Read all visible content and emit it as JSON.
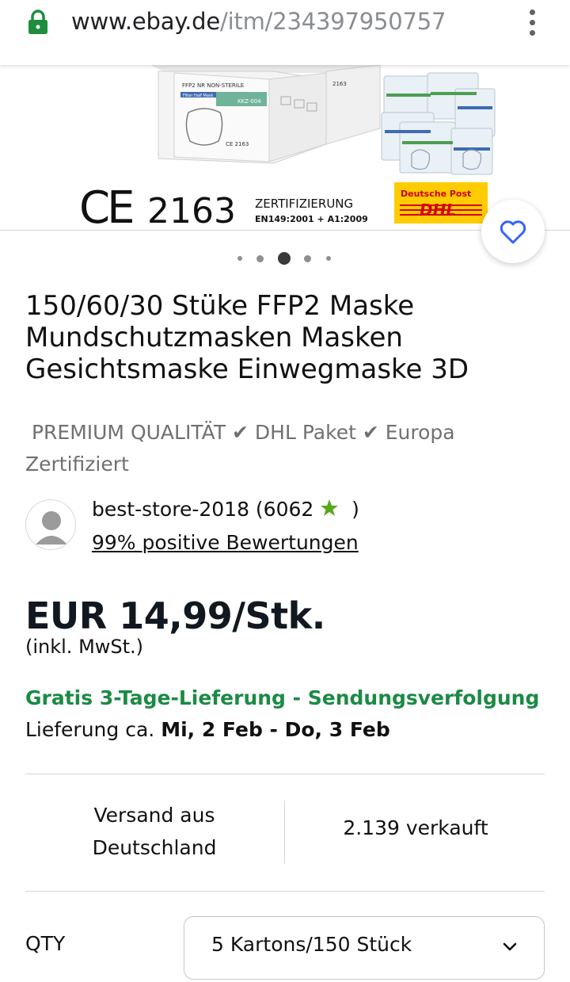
{
  "browser": {
    "url_host": "www.ebay.de",
    "url_path": "/itm/234397950757",
    "lock_icon": "lock-icon",
    "menu_icon": "more-vert-icon"
  },
  "gallery": {
    "image_texts": {
      "ce_mark": "CE",
      "ce_number": "2163",
      "cert_title": "ZERTIFIZIERUNG",
      "cert_norm": "EN149:2001 + A1:2009",
      "box_label": "FFP2 NR NON-STERILE",
      "box_sub": "Filter Half Mask",
      "box_code": "KKZ-004",
      "box_ce": "CE 2163",
      "box2_ce": "2163",
      "dp_text": "Deutsche Post",
      "dhl_text": "DHL"
    },
    "dots_count": 5,
    "active_dot": 2
  },
  "watch_icon": "heart-icon",
  "product": {
    "title_line1": "150/60/30 Stüke FFP2 Maske",
    "title_line2": "Mundschutzmasken Masken",
    "title_line3": "Gesichtsmaske Einwegmaske 3D",
    "subtitle_line1": " PREMIUM QUALITÄT ✔ DHL Paket ✔ Europa",
    "subtitle_line2": "Zertifiziert"
  },
  "seller": {
    "avatar_icon": "user-avatar-icon",
    "name": "best-store-2018 (6062",
    "star_icon": "star-icon",
    "close": " )",
    "feedback": "99% positive Bewertungen",
    "star_color": "#5ba71b"
  },
  "price": {
    "amount": "EUR 14,99/Stk.",
    "vat": "(inkl. MwSt.)"
  },
  "shipping": {
    "free": "Gratis 3-Tage-Lieferung - Sendungsverfolgung",
    "delivery_prefix": "Lieferung ca.",
    "delivery_dates": "Mi, 2 Feb - Do, 3 Feb",
    "accent_color": "#1c8a45"
  },
  "stats": {
    "origin_line1": "Versand aus",
    "origin_line2": "Deutschland",
    "sold": "2.139 verkauft"
  },
  "quantity": {
    "label": "QTY",
    "selected": "5 Kartons/150 Stück",
    "chevron_icon": "chevron-down-icon"
  }
}
